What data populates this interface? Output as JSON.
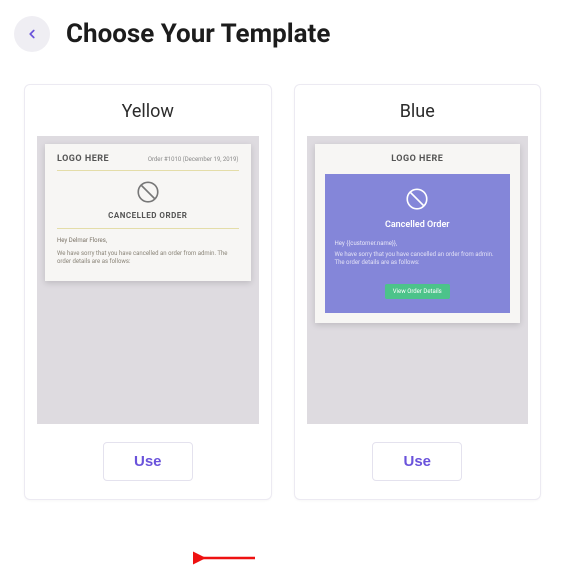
{
  "page": {
    "title": "Choose Your Template"
  },
  "templates": [
    {
      "name": "Yellow",
      "use_label": "Use",
      "preview": {
        "logo": "LOGO HERE",
        "order_meta": "Order #1010 (December 19, 2019)",
        "heading": "CANCELLED ORDER",
        "greeting": "Hey Delmar Flores,",
        "body": "We have sorry that you have cancelled an order from admin. The order details are as follows:"
      }
    },
    {
      "name": "Blue",
      "use_label": "Use",
      "preview": {
        "logo": "LOGO HERE",
        "heading": "Cancelled Order",
        "greeting": "Hey {{customer.name}},",
        "body": "We have sorry that you have cancelled an order from admin. The order details are as follows:",
        "cta": "View Order Details"
      }
    }
  ]
}
